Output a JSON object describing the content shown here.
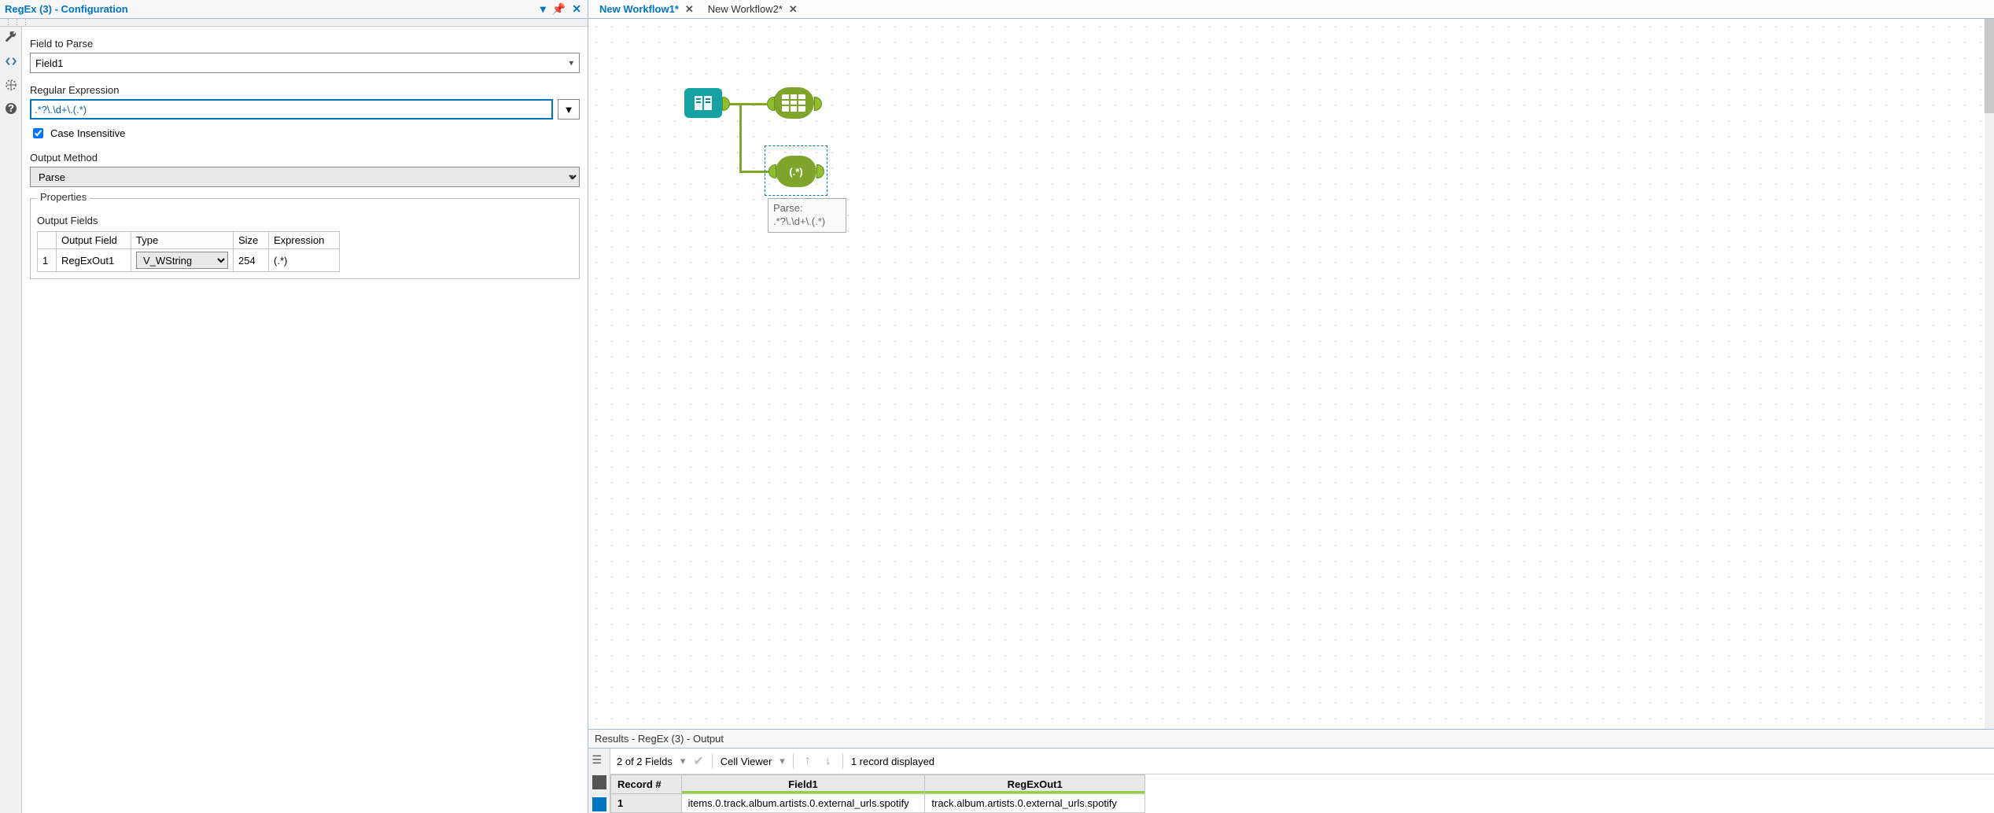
{
  "panel": {
    "title": "RegEx (3) - Configuration"
  },
  "config": {
    "field_to_parse_label": "Field to Parse",
    "field_to_parse_value": "Field1",
    "regex_label": "Regular Expression",
    "regex_value": ".*?\\.\\d+\\.(.*)",
    "case_insensitive_label": "Case Insensitive",
    "case_insensitive_checked": true,
    "output_method_label": "Output Method",
    "output_method_value": "Parse",
    "properties_label": "Properties",
    "output_fields_label": "Output Fields",
    "table_headers": {
      "row": "",
      "output_field": "Output Field",
      "type": "Type",
      "size": "Size",
      "expression": "Expression"
    },
    "rows": [
      {
        "idx": "1",
        "field": "RegExOut1",
        "type": "V_WString",
        "size": "254",
        "expr": "(.*)"
      }
    ]
  },
  "tabs": [
    {
      "label": "New Workflow1*",
      "active": true
    },
    {
      "label": "New Workflow2*",
      "active": false
    }
  ],
  "parse_tooltip": {
    "line1": "Parse:",
    "line2": ".*?\\.\\d+\\.(.*)"
  },
  "results": {
    "header": "Results - RegEx (3) - Output",
    "fields_label": "2 of 2 Fields",
    "cell_viewer_label": "Cell Viewer",
    "records_label": "1 record displayed",
    "columns": [
      "Record #",
      "Field1",
      "RegExOut1"
    ],
    "rows": [
      {
        "recno": "1",
        "field1": "items.0.track.album.artists.0.external_urls.spotify",
        "regexout1": "track.album.artists.0.external_urls.spotify"
      }
    ]
  }
}
